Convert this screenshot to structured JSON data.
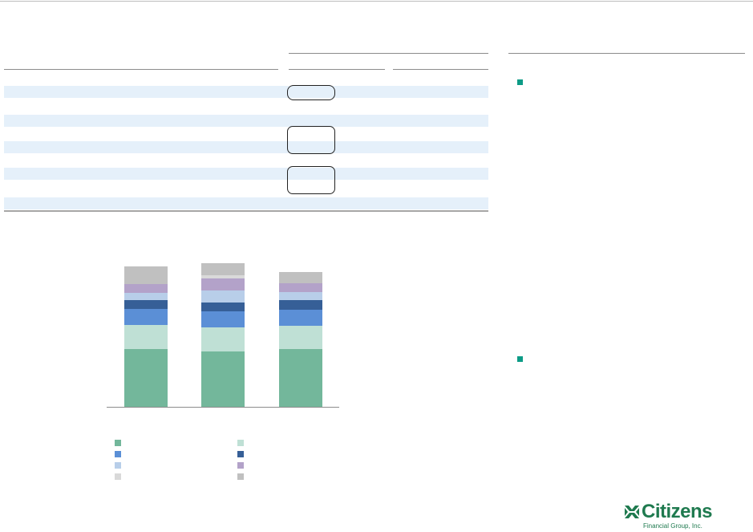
{
  "table": {
    "row_count": 8,
    "highlighted_cells": [
      "row-1",
      "row-4",
      "row-6"
    ]
  },
  "chart_data": {
    "type": "bar",
    "stacked": true,
    "categories": [
      "",
      "",
      ""
    ],
    "series": [
      {
        "values": [
          72,
          69,
          72
        ],
        "color": "#73b79b"
      },
      {
        "values": [
          30,
          30,
          29
        ],
        "color": "#bfe0d5"
      },
      {
        "values": [
          20,
          20,
          20
        ],
        "color": "#5b8fd6"
      },
      {
        "values": [
          11,
          11,
          12
        ],
        "color": "#365f97"
      },
      {
        "values": [
          9,
          15,
          10
        ],
        "color": "#b8cee9"
      },
      {
        "values": [
          11,
          15,
          11
        ],
        "color": "#b3a2c9"
      },
      {
        "values": [
          0,
          4,
          0
        ],
        "color": "#d9d9d9"
      },
      {
        "values": [
          22,
          15,
          14
        ],
        "color": "#c0c0c0"
      }
    ],
    "ylim": [
      0,
      185
    ],
    "legend": {
      "position": "bottom",
      "columns": 2
    },
    "grid": false
  },
  "bullets": {
    "count": 2
  },
  "logo": {
    "name": "Citizens",
    "sub": "Financial Group, Inc.",
    "mark_icon": "citizens-logo-icon"
  }
}
